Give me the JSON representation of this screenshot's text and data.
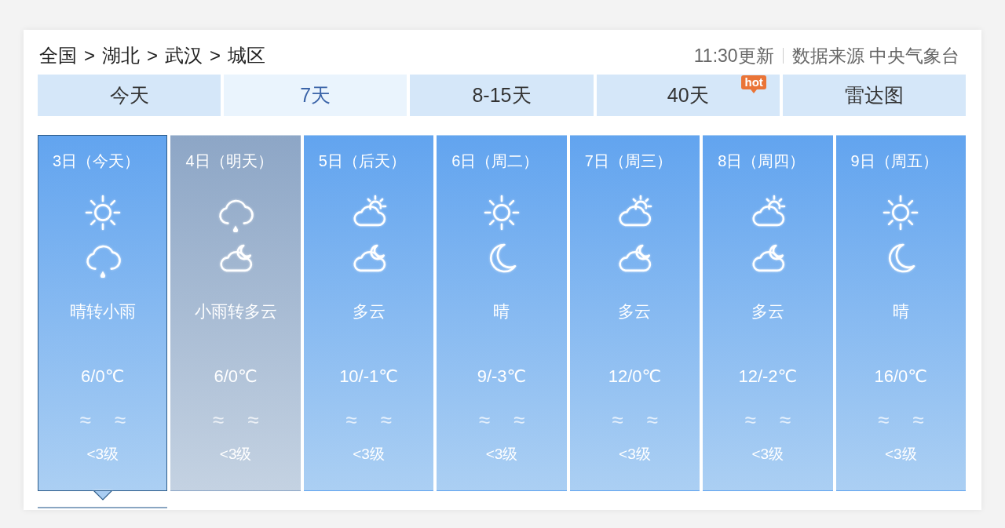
{
  "location": {
    "breadcrumb": [
      {
        "text": "全国"
      },
      {
        "separator": ">",
        "text": "湖北"
      },
      {
        "separator": ">",
        "text": "武汉"
      },
      {
        "separator": ">",
        "text": "城区"
      }
    ]
  },
  "update_info": {
    "updated": "11:30更新",
    "source": "数据来源 中央气象台"
  },
  "tabs": [
    {
      "label": "今天",
      "selected": false
    },
    {
      "label": "7天",
      "selected": true
    },
    {
      "label": "8-15天",
      "selected": false
    },
    {
      "label": "40天",
      "selected": false,
      "badge": "hot"
    },
    {
      "label": "雷达图",
      "selected": false
    }
  ],
  "days": [
    {
      "date": "3日（今天）",
      "icons": [
        {
          "kind": "sun"
        },
        {
          "kind": "rain"
        }
      ],
      "weather": "晴转小雨",
      "temperature": "6/0℃",
      "wind_icons": [
        "≈",
        "≈"
      ],
      "wind_level": "<3级",
      "selected": true,
      "hovered": false
    },
    {
      "date": "4日（明天）",
      "icons": [
        {
          "kind": "rain"
        },
        {
          "kind": "cloud-moon"
        }
      ],
      "weather": "小雨转多云",
      "temperature": "6/0℃",
      "wind_icons": [
        "≈",
        "≈"
      ],
      "wind_level": "<3级",
      "selected": false,
      "hovered": true
    },
    {
      "date": "5日（后天）",
      "icons": [
        {
          "kind": "cloud-sun"
        },
        {
          "kind": "cloud-moon"
        }
      ],
      "weather": "多云",
      "temperature": "10/-1℃",
      "wind_icons": [
        "≈",
        "≈"
      ],
      "wind_level": "<3级",
      "selected": false,
      "hovered": false
    },
    {
      "date": "6日（周二）",
      "icons": [
        {
          "kind": "sun"
        },
        {
          "kind": "moon"
        }
      ],
      "weather": "晴",
      "temperature": "9/-3℃",
      "wind_icons": [
        "≈",
        "≈"
      ],
      "wind_level": "<3级",
      "selected": false,
      "hovered": false
    },
    {
      "date": "7日（周三）",
      "icons": [
        {
          "kind": "cloud-sun"
        },
        {
          "kind": "cloud-moon"
        }
      ],
      "weather": "多云",
      "temperature": "12/0℃",
      "wind_icons": [
        "≈",
        "≈"
      ],
      "wind_level": "<3级",
      "selected": false,
      "hovered": false
    },
    {
      "date": "8日（周四）",
      "icons": [
        {
          "kind": "cloud-sun"
        },
        {
          "kind": "cloud-moon"
        }
      ],
      "weather": "多云",
      "temperature": "12/-2℃",
      "wind_icons": [
        "≈",
        "≈"
      ],
      "wind_level": "<3级",
      "selected": false,
      "hovered": false
    },
    {
      "date": "9日（周五）",
      "icons": [
        {
          "kind": "sun"
        },
        {
          "kind": "moon"
        }
      ],
      "weather": "晴",
      "temperature": "16/0℃",
      "wind_icons": [
        "≈",
        "≈"
      ],
      "wind_level": "<3级",
      "selected": false,
      "hovered": false
    }
  ]
}
